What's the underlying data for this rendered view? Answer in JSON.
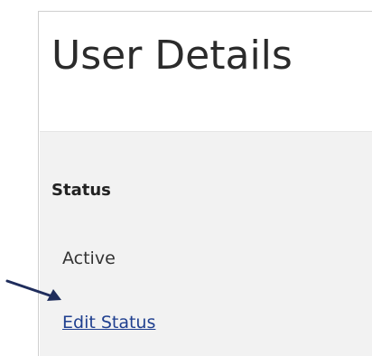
{
  "page": {
    "title": "User Details"
  },
  "status_section": {
    "label": "Status",
    "value": "Active",
    "edit_link": "Edit Status"
  },
  "annotation": {
    "arrow_color": "#1f2d5c"
  },
  "colors": {
    "link": "#1f3f8f",
    "section_background": "#f2f2f2"
  }
}
